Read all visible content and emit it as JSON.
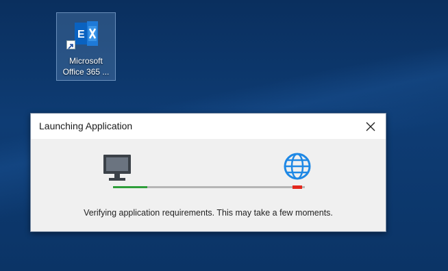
{
  "desktop": {
    "shortcut": {
      "label_line1": "Microsoft",
      "label_line2": "Office 365 ...",
      "icon": "exchange-logo-icon"
    }
  },
  "dialog": {
    "title": "Launching Application",
    "close_icon": "close-icon",
    "client_icon": "monitor-icon",
    "server_icon": "globe-icon",
    "progress_fraction": 0.18,
    "status": "Verifying application requirements. This may take a few moments.",
    "colors": {
      "progress": "#2e9e3a",
      "track": "#b5b5b5",
      "endpoint": "#e3271c",
      "globe": "#1e88e5"
    }
  }
}
